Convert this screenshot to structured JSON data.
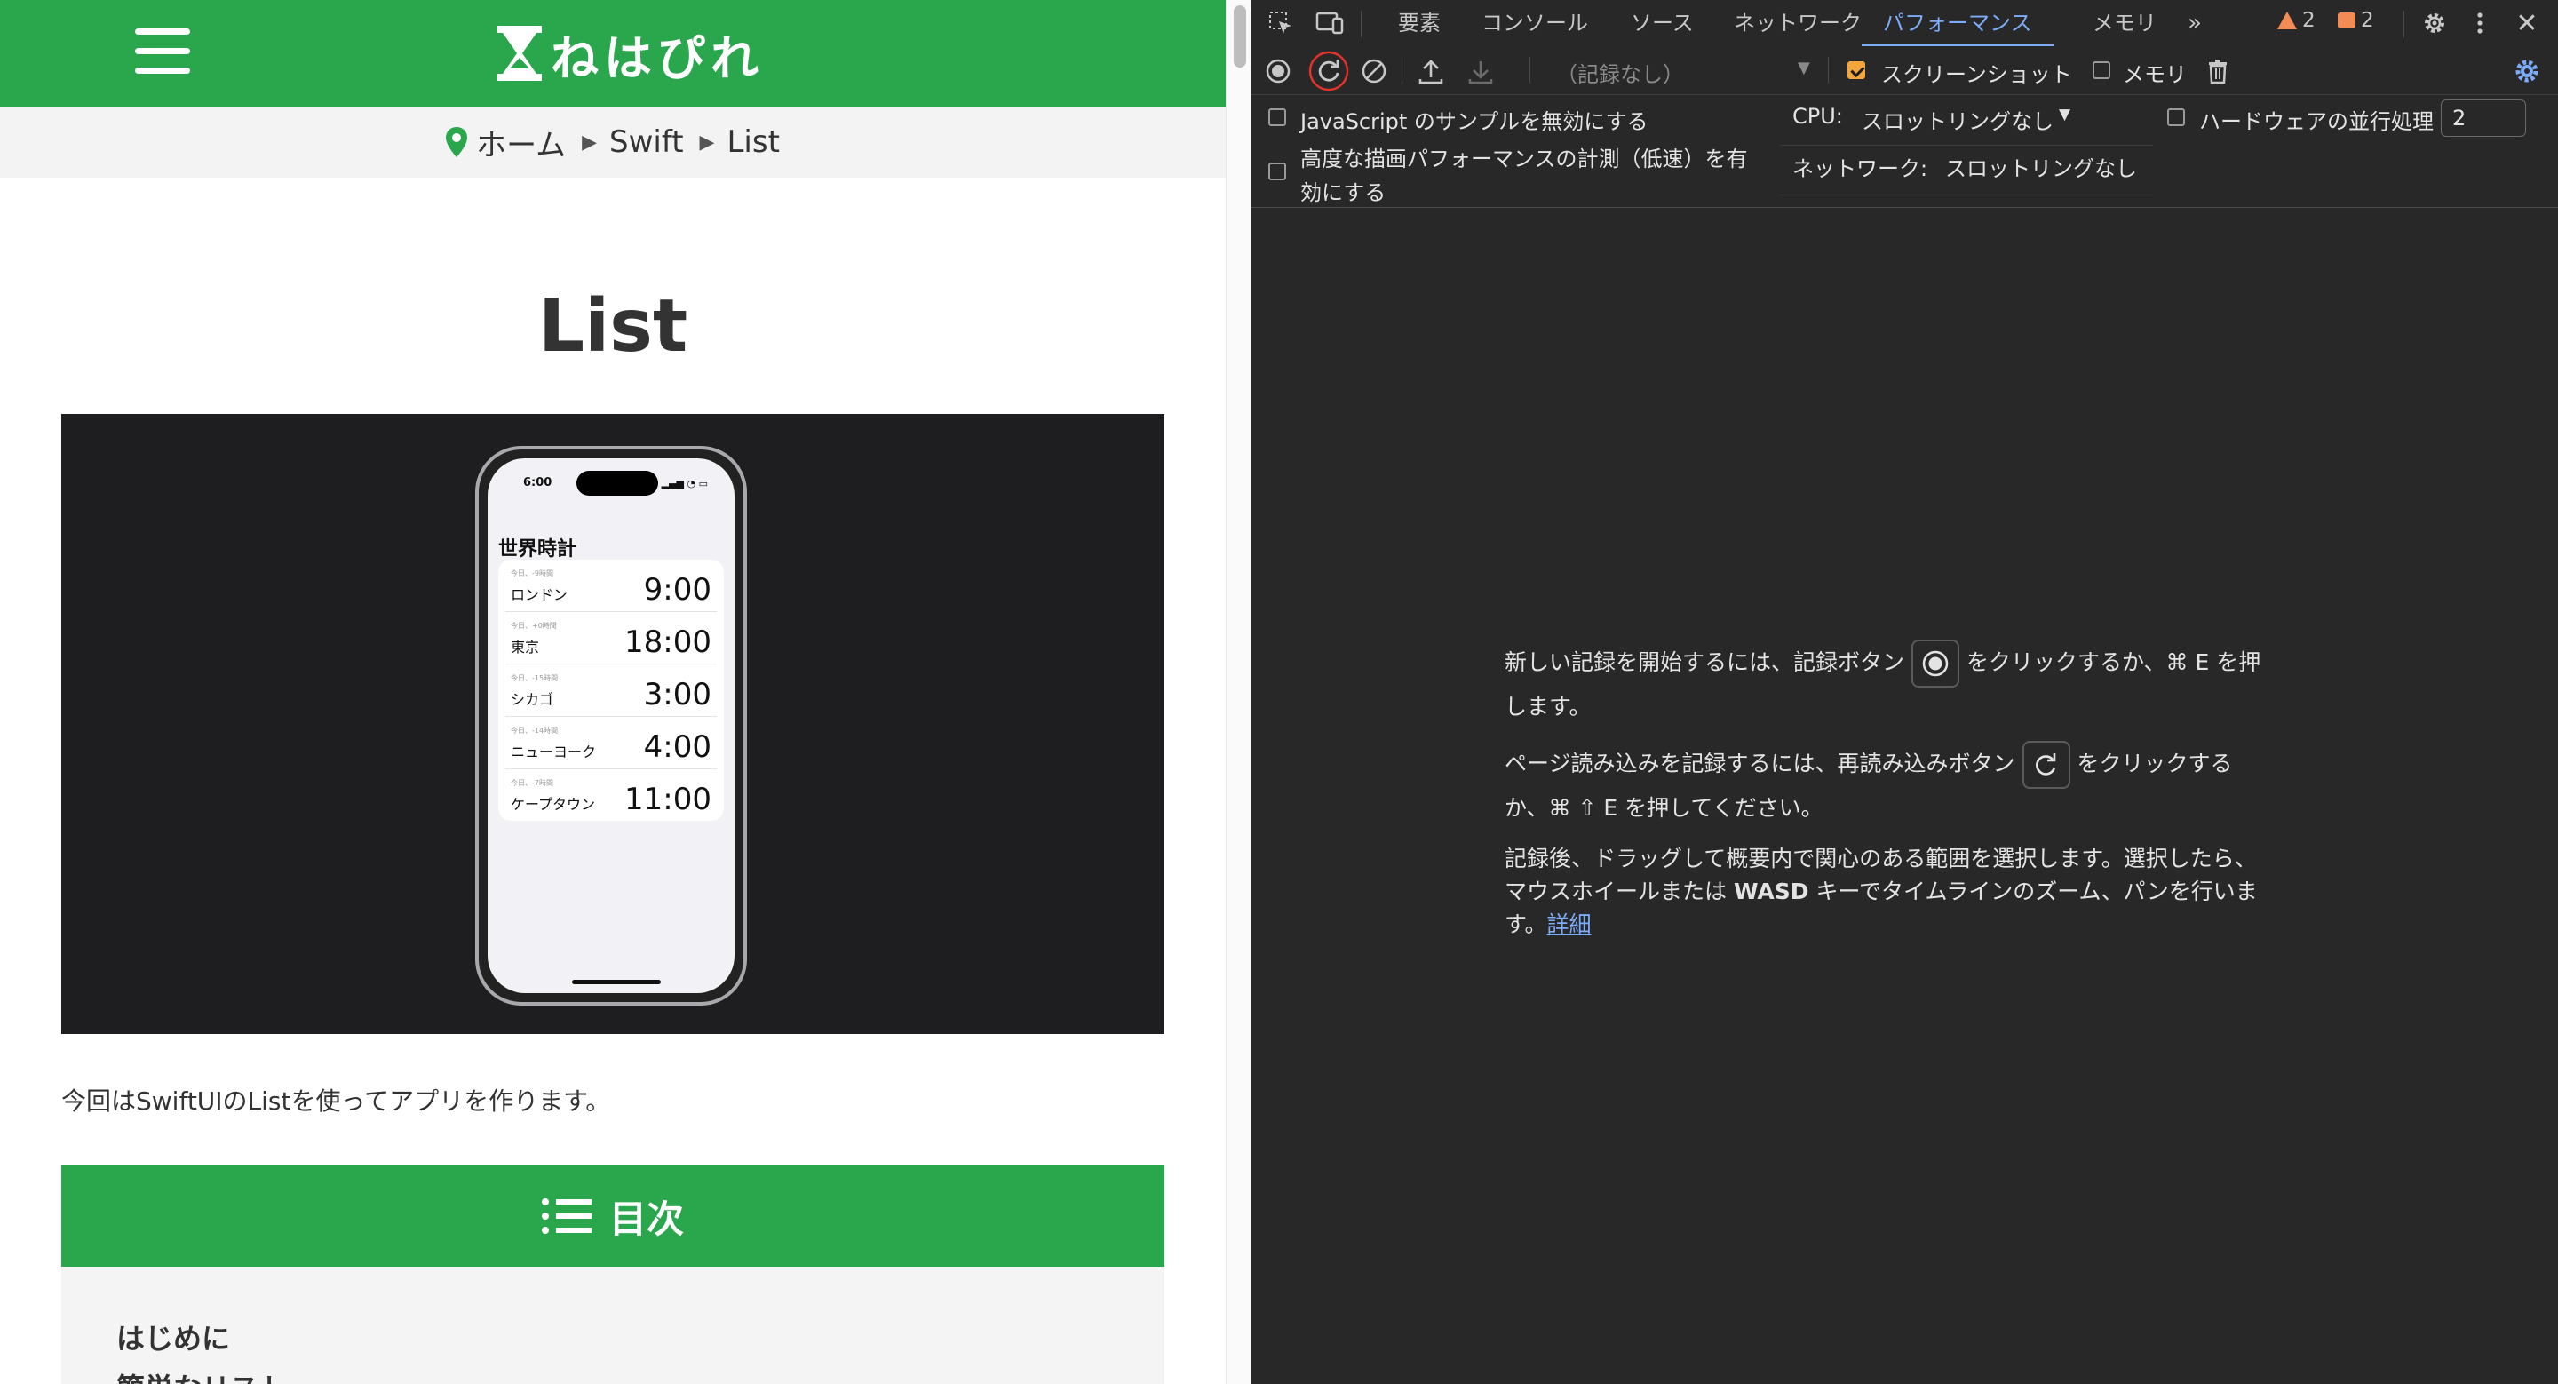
{
  "site": {
    "logo_text": "ねはぴれ",
    "breadcrumb": [
      "ホーム",
      "Swift",
      "List"
    ],
    "title": "List",
    "hero": {
      "status_time": "6:00",
      "heading": "世界時計",
      "clocks": [
        {
          "offset": "今日、-9時間",
          "city": "ロンドン",
          "time": "9:00"
        },
        {
          "offset": "今日、+0時間",
          "city": "東京",
          "time": "18:00"
        },
        {
          "offset": "今日、-15時間",
          "city": "シカゴ",
          "time": "3:00"
        },
        {
          "offset": "今日、-14時間",
          "city": "ニューヨーク",
          "time": "4:00"
        },
        {
          "offset": "今日、-7時間",
          "city": "ケープタウン",
          "time": "11:00"
        }
      ]
    },
    "intro": "今回はSwiftUIのListを使ってアプリを作ります。",
    "toc": {
      "title": "目次",
      "items": [
        "はじめに",
        "簡単なリスト"
      ]
    }
  },
  "devtools": {
    "tabs": [
      "要素",
      "コンソール",
      "ソース",
      "ネットワーク",
      "パフォーマンス",
      "メモリ"
    ],
    "active_tab": "パフォーマンス",
    "warnings_count": "2",
    "issues_count": "2",
    "recording_select": "（記録なし）",
    "screenshot_label": "スクリーンショット",
    "memory_label": "メモリ",
    "settings": {
      "disable_js_samples": "JavaScript のサンプルを無効にする",
      "advanced_paint_line1": "高度な描画パフォーマンスの計測（低速）を有",
      "advanced_paint_line2": "効にする",
      "cpu_label": "CPU:",
      "cpu_value": "スロットリングなし",
      "network_label": "ネットワーク:",
      "network_value": "スロットリングなし",
      "hw_concurrency_label": "ハードウェアの並行処理",
      "hw_concurrency_value": "2"
    },
    "landing": {
      "record_pre": "新しい記録を開始するには、記録ボタン",
      "record_post": "をクリックするか、⌘ E を押",
      "record_post2": "します。",
      "reload_pre": "ページ読み込みを記録するには、再読み込みボタン",
      "reload_post": "をクリックする",
      "reload_post2": "か、⌘ ⇧ E を押してください。",
      "after_line1": "記録後、ドラッグして概要内で関心のある範囲を選択します。選択したら、",
      "after_line2_pre": "マウスホイールまたは",
      "after_line2_bold": "WASD",
      "after_line2_post": "キーでタイムラインのズーム、パンを行いま",
      "after_line3": "す。",
      "learn_more": "詳細"
    },
    "colors": {
      "accent": "#7cacf8",
      "highlight_ring": "#e0332b",
      "warning": "#f28b54",
      "checkbox_on": "#f4a53b"
    }
  }
}
